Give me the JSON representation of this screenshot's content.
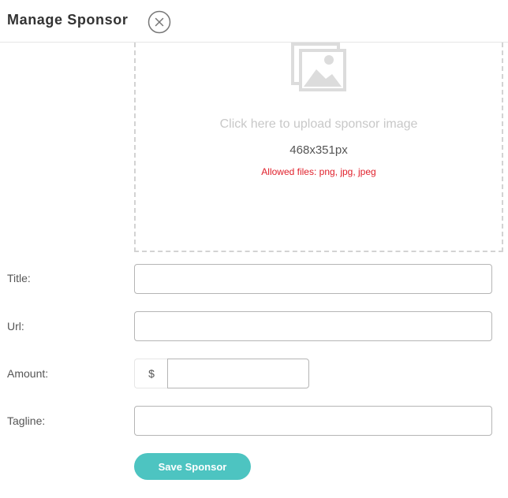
{
  "header": {
    "title": "Manage Sponsor"
  },
  "upload": {
    "prompt": "Click here to upload sponsor image",
    "dimensions": "468x351px",
    "allowed": "Allowed files: png, jpg, jpeg"
  },
  "form": {
    "title_label": "Title:",
    "title_value": "",
    "url_label": "Url:",
    "url_value": "",
    "amount_label": "Amount:",
    "amount_currency": "$",
    "amount_value": "",
    "tagline_label": "Tagline:",
    "tagline_value": ""
  },
  "actions": {
    "save_label": "Save Sponsor"
  },
  "colors": {
    "accent": "#4dc4c1",
    "error": "#e0202b",
    "placeholder_gray": "#c8c8c8"
  },
  "icons": {
    "close": "close-circle-icon",
    "upload": "image-placeholder-icon"
  }
}
